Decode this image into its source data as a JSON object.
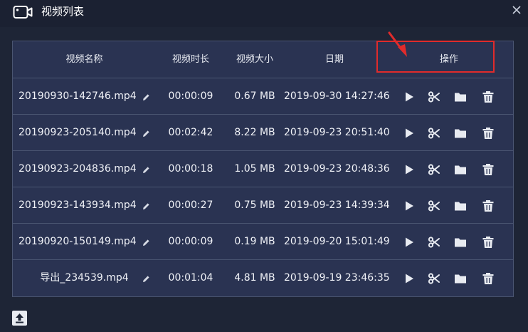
{
  "window": {
    "title": "视频列表",
    "title_icon": "video-camera-icon",
    "close_icon": "close-icon"
  },
  "table": {
    "headers": {
      "name": "视频名称",
      "duration": "视频时长",
      "size": "视频大小",
      "date": "日期",
      "actions": "操作"
    },
    "rows": [
      {
        "name": "20190930-142746.mp4",
        "duration": "00:00:09",
        "size": "0.67 MB",
        "date": "2019-09-30 14:27:46"
      },
      {
        "name": "20190923-205140.mp4",
        "duration": "00:02:42",
        "size": "8.22 MB",
        "date": "2019-09-23 20:51:40"
      },
      {
        "name": "20190923-204836.mp4",
        "duration": "00:00:18",
        "size": "1.05 MB",
        "date": "2019-09-23 20:48:36"
      },
      {
        "name": "20190923-143934.mp4",
        "duration": "00:00:27",
        "size": "0.75 MB",
        "date": "2019-09-23 14:39:34"
      },
      {
        "name": "20190920-150149.mp4",
        "duration": "00:00:09",
        "size": "0.19 MB",
        "date": "2019-09-20 15:01:49"
      },
      {
        "name": "导出_234539.mp4",
        "duration": "00:01:04",
        "size": "4.81 MB",
        "date": "2019-09-19 23:46:35"
      }
    ],
    "action_icons": [
      "play-icon",
      "scissors-icon",
      "folder-icon",
      "trash-icon"
    ],
    "row_icon": "pencil-icon"
  },
  "footer": {
    "upload_icon": "upload-icon"
  },
  "colors": {
    "background": "#1e2536",
    "panel": "#2a3352",
    "border": "#4a5571",
    "highlight": "#e02b2b"
  }
}
